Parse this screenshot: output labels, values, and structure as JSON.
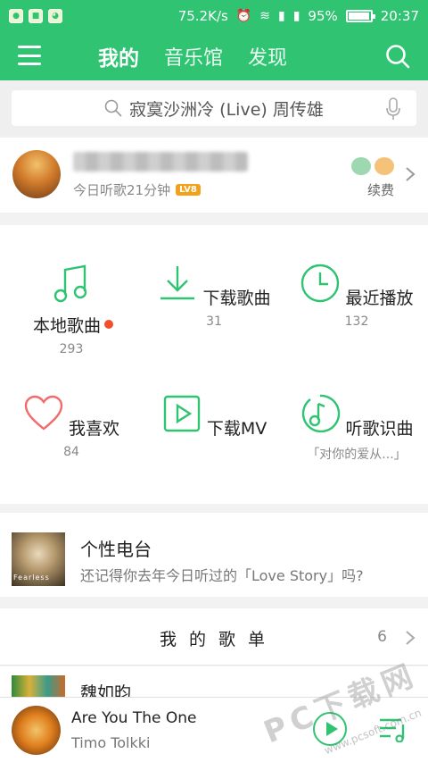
{
  "status_bar": {
    "network_speed": "75.2K/s",
    "battery": "95%",
    "battery_level": 0.95,
    "time": "20:37"
  },
  "top_nav": {
    "tabs": [
      "我的",
      "音乐馆",
      "发现"
    ]
  },
  "search": {
    "placeholder": "寂寞沙洲冷 (Live) 周传雄"
  },
  "profile": {
    "listen_today": "今日听歌21分钟",
    "level_badge": "LV8",
    "renew_label": "续费"
  },
  "grid": [
    {
      "label": "本地歌曲",
      "count": "293",
      "icon": "music-note-icon"
    },
    {
      "label": "下载歌曲",
      "count": "31",
      "icon": "download-icon"
    },
    {
      "label": "最近播放",
      "count": "132",
      "icon": "clock-icon"
    },
    {
      "label": "我喜欢",
      "count": "84",
      "icon": "heart-icon"
    },
    {
      "label": "下载MV",
      "count": "",
      "icon": "video-play-icon"
    },
    {
      "label": "听歌识曲",
      "count": "「对你的爱从...」",
      "icon": "music-recognize-icon"
    }
  ],
  "radio": {
    "title": "个性电台",
    "subtitle": "还记得你去年今日听过的「Love Story」吗?",
    "thumb_text": "Fearless"
  },
  "playlists": {
    "title": "我 的 歌 单",
    "count": "6",
    "first_item": "魏如昀"
  },
  "player": {
    "song": "Are You The One",
    "artist": "Timo Tolkki"
  },
  "watermark": {
    "text": "PC下载网",
    "url": "www.pcsoft.com.cn"
  },
  "colors": {
    "brand_green": "#2fc372",
    "heart_red": "#f26b6b",
    "dot_red": "#f2502b"
  }
}
